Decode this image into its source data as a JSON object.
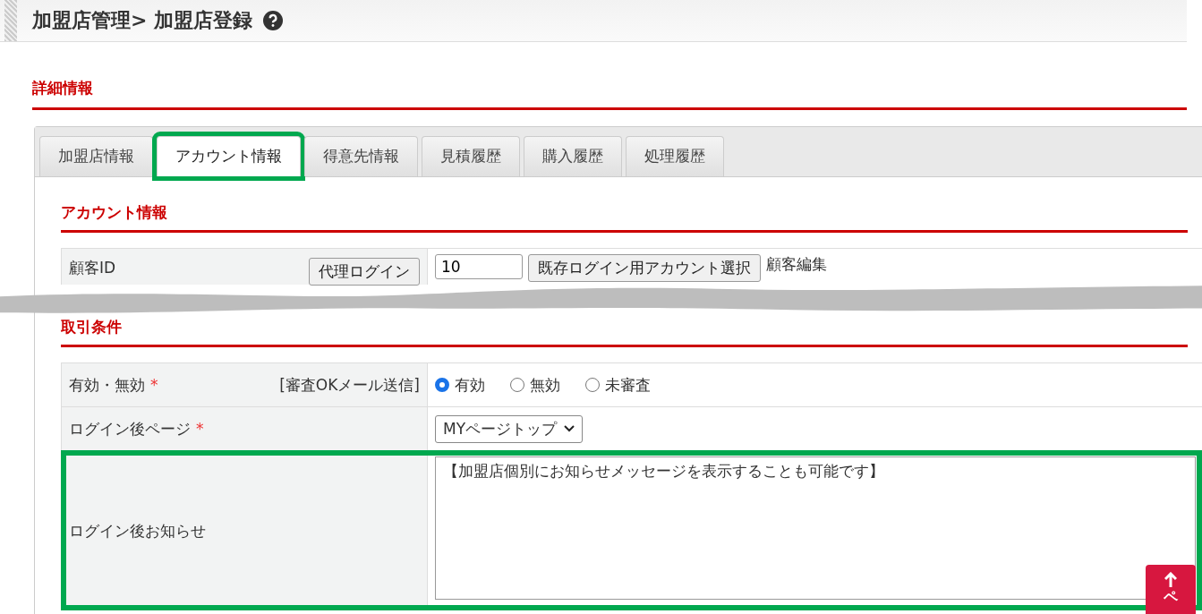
{
  "breadcrumb": {
    "title": "加盟店管理> 加盟店登録"
  },
  "section": {
    "title": "詳細情報"
  },
  "tabs": [
    {
      "label": "加盟店情報",
      "selected": false,
      "highlighted": false
    },
    {
      "label": "アカウント情報",
      "selected": true,
      "highlighted": true
    },
    {
      "label": "得意先情報",
      "selected": false,
      "highlighted": false
    },
    {
      "label": "見積履歴",
      "selected": false,
      "highlighted": false
    },
    {
      "label": "購入履歴",
      "selected": false,
      "highlighted": false
    },
    {
      "label": "処理履歴",
      "selected": false,
      "highlighted": false
    }
  ],
  "account": {
    "title": "アカウント情報",
    "label": "顧客ID",
    "proxy_button": "代理ログイン",
    "customer_id": "10",
    "select_button": "既存ログイン用アカウント選択",
    "edit_link": "顧客編集"
  },
  "terms": {
    "title": "取引条件",
    "rows": [
      {
        "kind": "radio",
        "label": "有効・無効",
        "required_mark": "*",
        "note": "[審査OKメール送信]",
        "highlighted": false,
        "options": [
          {
            "label": "有効",
            "selected": true
          },
          {
            "label": "無効",
            "selected": false
          },
          {
            "label": "未審査",
            "selected": false
          }
        ]
      },
      {
        "kind": "select",
        "label": "ログイン後ページ",
        "required_mark": "*",
        "highlighted": false,
        "value": "MYページトップ"
      },
      {
        "kind": "textarea",
        "label": "ログイン後お知らせ",
        "highlighted": true,
        "value": "【加盟店個別にお知らせメッセージを表示することも可能です】"
      }
    ]
  },
  "page_top": {
    "label": "ペ"
  }
}
